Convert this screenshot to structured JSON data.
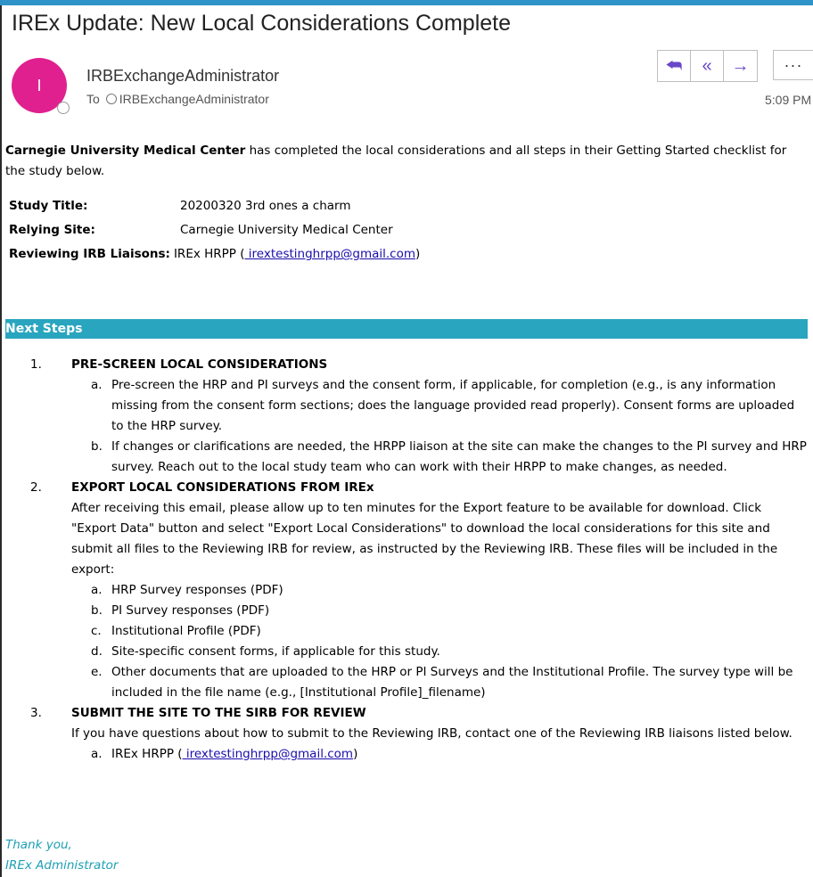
{
  "email": {
    "subject": "IREx Update: New Local Considerations Complete",
    "avatar_initial": "I",
    "sender": "IRBExchangeAdministrator",
    "to_label": "To",
    "to_recipient": "IRBExchangeAdministrator",
    "time": "5:09 PM",
    "actions": {
      "reply_icon": "reply-icon",
      "reply_all_icon": "reply-all-icon",
      "forward_icon": "forward-icon",
      "more_icon": "more-icon",
      "reply_glyph": "⮪",
      "reply_all_glyph": "«",
      "forward_glyph": "→",
      "more_glyph": "···"
    }
  },
  "body": {
    "intro_bold": "Carnegie University Medical Center",
    "intro_rest": " has completed the local considerations and all steps in their Getting Started checklist for the study below.",
    "info": {
      "study_title_label": "Study Title:",
      "study_title_value": "20200320 3rd ones a charm",
      "relying_site_label": "Relying Site:",
      "relying_site_value": "Carnegie University Medical Center",
      "liaisons_label": "Reviewing IRB Liaisons:",
      "liaisons_prefix": "IREx HRPP (",
      "liaisons_email": " irextestinghrpp@gmail.com",
      "liaisons_suffix": ")"
    },
    "next_steps_header": "Next Steps",
    "steps": [
      {
        "num": "1.",
        "title": "PRE-SCREEN LOCAL CONSIDERATIONS",
        "items": [
          {
            "letter": "a.",
            "text": "Pre-screen the HRP and PI surveys and the consent form, if applicable, for completion (e.g., is any information missing from the consent form sections; does the language provided read properly). Consent forms are uploaded to the HRP survey."
          },
          {
            "letter": "b.",
            "text": "If changes or clarifications are needed, the HRPP liaison at the site can make the changes to the PI survey and HRP survey. Reach out to the local study team who can work with their HRPP to make changes, as needed."
          }
        ]
      },
      {
        "num": "2.",
        "title": "EXPORT LOCAL CONSIDERATIONS FROM IREx",
        "desc": "After receiving this email, please allow up to ten minutes for the Export feature to be available for download. Click \"Export Data\" button and select \"Export Local Considerations\" to download the local considerations for this site and submit all files to the Reviewing IRB for review, as instructed by the Reviewing IRB. These files will be included in the export:",
        "items": [
          {
            "letter": "a.",
            "text": "HRP Survey responses (PDF)"
          },
          {
            "letter": "b.",
            "text": "PI Survey responses (PDF)"
          },
          {
            "letter": "c.",
            "text": "Institutional Profile (PDF)"
          },
          {
            "letter": "d.",
            "text": "Site-specific consent forms, if applicable for this study."
          },
          {
            "letter": "e.",
            "text": "Other documents that are uploaded to the HRP or PI Surveys and the Institutional Profile. The survey type will be included in the file name (e.g., [Institutional Profile]_filename)"
          }
        ]
      },
      {
        "num": "3.",
        "title": "SUBMIT THE SITE TO THE SIRB FOR REVIEW",
        "desc": "If you have questions about how to submit to the Reviewing IRB, contact one of the Reviewing IRB liaisons listed below.",
        "items": [
          {
            "letter": "a.",
            "prefix": "IREx HRPP (",
            "email": " irextestinghrpp@gmail.com",
            "suffix": ")"
          }
        ]
      }
    ],
    "closing_line1": "Thank you,",
    "closing_line2": "IREx Administrator"
  }
}
